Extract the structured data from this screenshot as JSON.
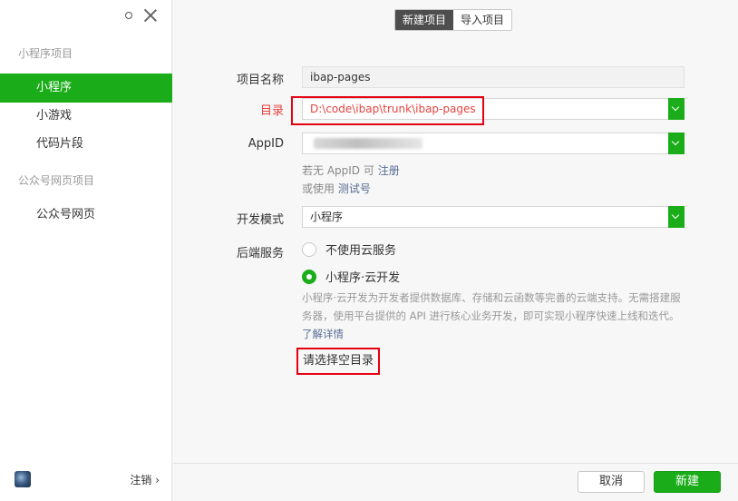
{
  "sidebar": {
    "section1": "小程序项目",
    "items1": [
      {
        "label": "小程序"
      },
      {
        "label": "小游戏"
      },
      {
        "label": "代码片段"
      }
    ],
    "section2": "公众号网页项目",
    "items2": [
      {
        "label": "公众号网页"
      }
    ],
    "logout": "注销 ›"
  },
  "tabs": {
    "new": "新建项目",
    "import": "导入项目"
  },
  "form": {
    "name_label": "项目名称",
    "name_value": "ibap-pages",
    "dir_label": "目录",
    "dir_value": "D:\\code\\ibap\\trunk\\ibap-pages",
    "appid_label": "AppID",
    "appid_hint1": "若无 AppID 可",
    "appid_hint1_link": "注册",
    "appid_hint2": "或使用",
    "appid_hint2_link": "测试号",
    "mode_label": "开发模式",
    "mode_value": "小程序",
    "backend_label": "后端服务",
    "backend_opt1": "不使用云服务",
    "backend_opt2": "小程序·云开发",
    "backend_desc": "小程序·云开发为开发者提供数据库、存储和云函数等完善的云端支持。无需搭建服务器，使用平台提供的 API 进行核心业务开发，即可实现小程序快速上线和迭代。",
    "backend_link": "了解详情",
    "pick_empty": "请选择空目录"
  },
  "footer": {
    "cancel": "取消",
    "create": "新建"
  },
  "colors": {
    "accent": "#1aad19",
    "error": "#e64340",
    "link": "#576b95"
  }
}
